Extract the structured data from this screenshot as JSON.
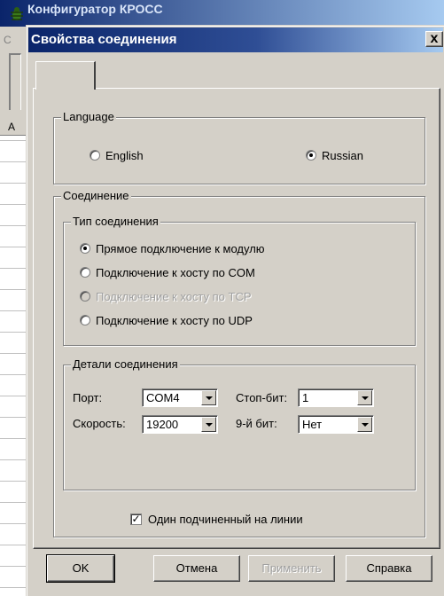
{
  "background_window": {
    "title": "Конфигуратор КРОСС",
    "menu_fragment": "С",
    "grid_header": "А"
  },
  "dialog": {
    "title": "Свойства соединения",
    "close_glyph": "x",
    "tabs": [
      {
        "label": ""
      }
    ]
  },
  "language": {
    "legend": "Language",
    "options": [
      {
        "label": "English",
        "checked": false
      },
      {
        "label": "Russian",
        "checked": true
      }
    ]
  },
  "connection": {
    "legend": "Соединение",
    "type": {
      "legend": "Тип соединения",
      "options": [
        {
          "label": "Прямое подключение к модулю",
          "checked": true,
          "enabled": true
        },
        {
          "label": "Подключение к хосту по COM",
          "checked": false,
          "enabled": true
        },
        {
          "label": "Подключение к хосту по TCP",
          "checked": false,
          "enabled": false
        },
        {
          "label": "Подключение к хосту по UDP",
          "checked": false,
          "enabled": true
        }
      ]
    },
    "details": {
      "legend": "Детали соединения",
      "port_label": "Порт:",
      "port_value": "COM4",
      "speed_label": "Скорость:",
      "speed_value": "19200",
      "stopbits_label": "Стоп-бит:",
      "stopbits_value": "1",
      "ninth_bit_label": "9-й бит:",
      "ninth_bit_value": "Нет"
    },
    "single_slave": {
      "label": "Один подчиненный на линии",
      "checked": true
    }
  },
  "buttons": {
    "ok": "OK",
    "cancel": "Отмена",
    "apply": "Применить",
    "help": "Справка"
  },
  "colors": {
    "titlebar_active": "#0a246a",
    "face": "#d4d0c8",
    "disabled_text": "#a0a0a0"
  }
}
